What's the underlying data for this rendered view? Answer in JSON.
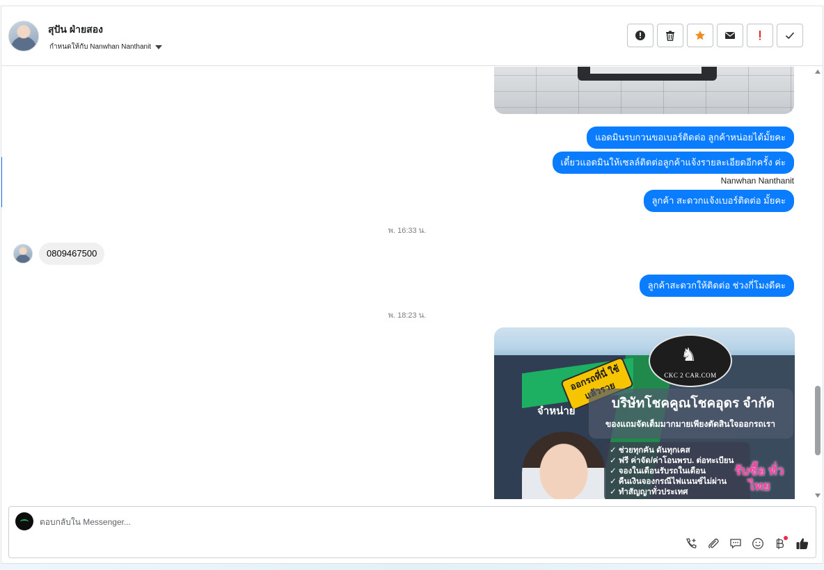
{
  "header": {
    "contact_name": "สุปัน ฝ่ายสอง",
    "assigned_to": "กำหนดให้กับ Nanwhan Nanthanit",
    "actions": [
      {
        "name": "report-button",
        "icon": "alert-circle-icon"
      },
      {
        "name": "delete-button",
        "icon": "trash-icon"
      },
      {
        "name": "star-button",
        "icon": "star-icon",
        "color": "#f28b1e"
      },
      {
        "name": "mark-unread-button",
        "icon": "envelope-icon"
      },
      {
        "name": "flag-important-button",
        "icon": "exclamation-icon",
        "color": "#e02424"
      },
      {
        "name": "mark-done-button",
        "icon": "check-icon"
      }
    ]
  },
  "messages": {
    "out_1": "แอดมินรบกวนขอเบอร์ติดต่อ ลูกค้าหน่อยได้มั้ยคะ",
    "out_2": "เดี๋ยวแอดมินให้เซลล์ติดต่อลูกค้าแจ้งรายละเอียดอีกครั้ง ค่ะ",
    "sender": "Nanwhan Nanthanit",
    "out_3": "ลูกค้า สะดวกแจ้งเบอร์ติดต่อ มั้ยคะ",
    "ts_1": "พ. 16:33 น.",
    "in_1": "0809467500",
    "out_4": "ลูกค้าสะดวกให้ติดต่อ ช่วงกี่โมงดีคะ",
    "ts_2": "พ. 18:23 น."
  },
  "ad": {
    "brand": "CKC 2 CAR.COM",
    "ribbon": "ออกรถที่นี่ ใช้แล้วรวย",
    "dist": "จำหน่าย",
    "company": "บริษัทโชคคูณโชคอุดร จำกัด",
    "tagline": "ของแถมจัดเต็มมากมายเพียงตัดสินใจออกรถเรา",
    "items": [
      "ช่วยทุกคัน ดันทุกเคส",
      "ฟรี ค่าจัด/ค่าโอนพรบ. ต่อทะเบียน",
      "จองในเดือนรับรถในเดือน",
      "คืนเงินจองกรณีไฟแนนซ์ไม่ผ่าน",
      "ทำสัญญาทั่วประเทศ"
    ],
    "badge": "รับซื้อ ทั่วไทย"
  },
  "composer": {
    "placeholder": "ตอบกลับใน Messenger...",
    "tools": [
      "phone-add-icon",
      "paperclip-icon",
      "chat-bubble-icon",
      "emoji-icon",
      "baht-icon",
      "thumbs-up-icon"
    ]
  },
  "colors": {
    "accent": "#0a7cff",
    "link_blue": "#1877f2"
  }
}
